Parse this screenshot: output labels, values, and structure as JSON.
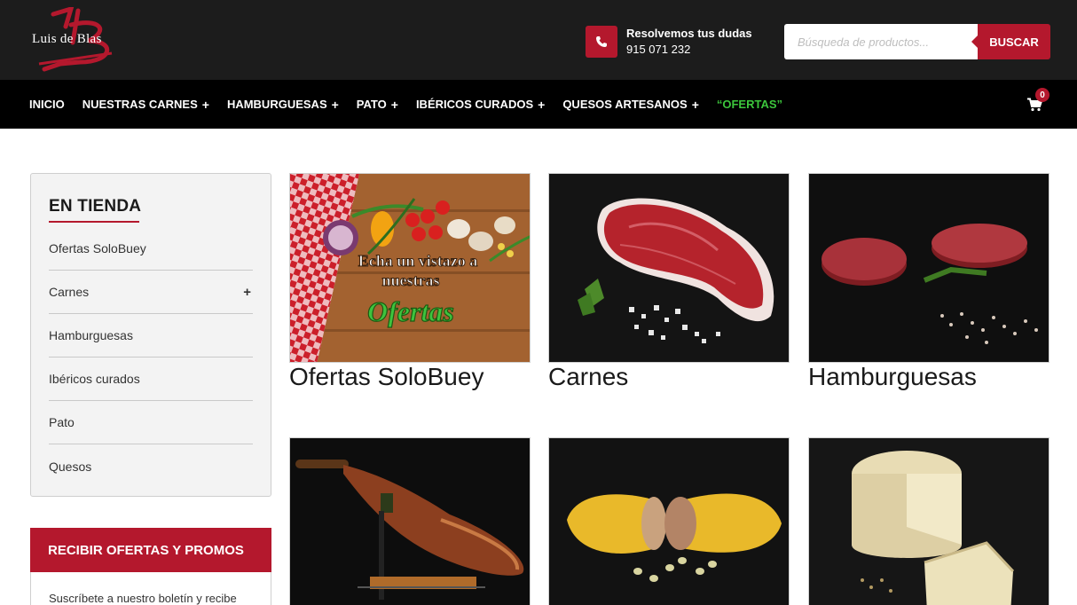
{
  "header": {
    "logo_text": "Luis de Blas",
    "contact_title": "Resolvemos tus dudas",
    "contact_phone": "915 071 232",
    "search_placeholder": "Búsqueda de productos...",
    "search_button": "BUSCAR",
    "icons": [
      "phone-icon",
      "cart-icon"
    ]
  },
  "nav": {
    "items": [
      {
        "label": "INICIO",
        "has_submenu": false
      },
      {
        "label": "NUESTRAS CARNES",
        "has_submenu": true
      },
      {
        "label": "HAMBURGUESAS",
        "has_submenu": true
      },
      {
        "label": "PATO",
        "has_submenu": true
      },
      {
        "label": "IBÉRICOS CURADOS",
        "has_submenu": true
      },
      {
        "label": "QUESOS ARTESANOS",
        "has_submenu": true
      },
      {
        "label": "“OFERTAS”",
        "has_submenu": false
      }
    ],
    "submenu_marker": "+",
    "cart_count": "0"
  },
  "sidebar": {
    "title": "EN TIENDA",
    "items": [
      {
        "label": "Ofertas SoloBuey",
        "expandable": false
      },
      {
        "label": "Carnes",
        "expandable": true
      },
      {
        "label": "Hamburguesas",
        "expandable": false
      },
      {
        "label": "Ibéricos curados",
        "expandable": false
      },
      {
        "label": "Pato",
        "expandable": false
      },
      {
        "label": "Quesos",
        "expandable": false
      }
    ],
    "expand_marker": "+",
    "promo_title": "RECIBIR OFERTAS Y PROMOS",
    "promo_text": "Suscríbete a nuestro boletín y recibe"
  },
  "categories": [
    {
      "label": "Ofertas SoloBuey",
      "banner_line1": "Echa un vistazo a",
      "banner_line2": "nuestras",
      "banner_line3": "Ofertas"
    },
    {
      "label": "Carnes"
    },
    {
      "label": "Hamburguesas"
    },
    {
      "label": ""
    },
    {
      "label": ""
    },
    {
      "label": ""
    }
  ],
  "colors": {
    "brand_red": "#b4182d",
    "header_bg": "#1c1c1c",
    "nav_bg": "#000000",
    "ofertas_green": "#3cc63c"
  }
}
